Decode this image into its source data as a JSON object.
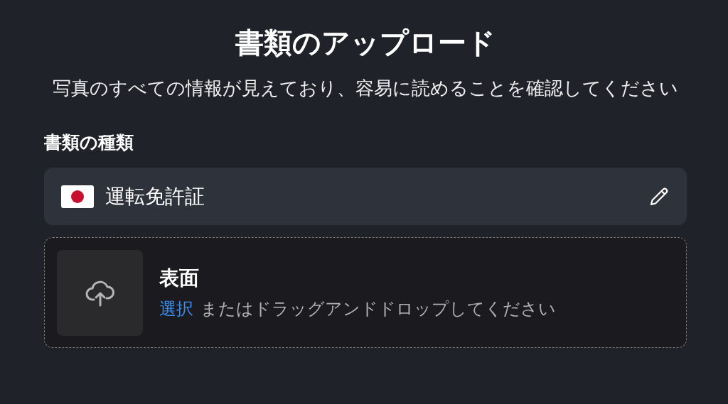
{
  "title": "書類のアップロード",
  "subtitle": "写真のすべての情報が見えており、容易に読めることを確認してください",
  "document_type": {
    "label": "書類の種類",
    "value": "運転免許証"
  },
  "upload": {
    "side": "表面",
    "link": "選択",
    "instruction": "またはドラッグアンドドロップしてください"
  }
}
